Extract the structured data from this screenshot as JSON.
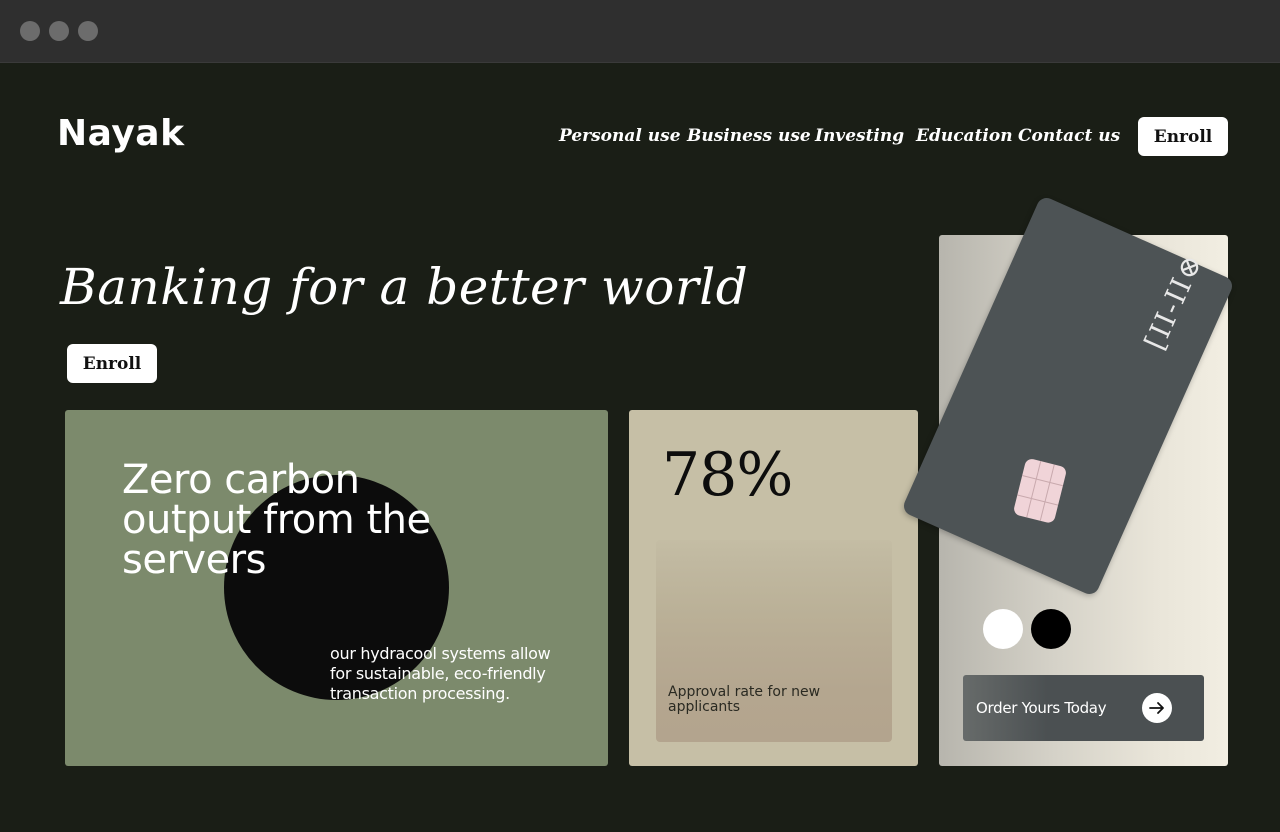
{
  "brand": {
    "name": "Nayak"
  },
  "nav": {
    "items": [
      "Personal use",
      "Business use",
      "Investing",
      "Education",
      "Contact us"
    ],
    "cta_label": "Enroll"
  },
  "hero": {
    "title": "Banking for a better world",
    "cta_label": "Enroll"
  },
  "feature_card": {
    "title": "Zero carbon output from the servers",
    "description": "our hydracool systems allow for sustainable, eco-friendly transaction processing."
  },
  "stat_card": {
    "value": "78%",
    "caption": "Approval rate for new applicants"
  },
  "product_card": {
    "card_mark": "[II-II⊗",
    "color_options": [
      "white",
      "black"
    ],
    "order_label": "Order Yours Today",
    "order_icon": "arrow-right-icon"
  },
  "colors": {
    "background": "#1a1e16",
    "green_card": "#7c8a6c",
    "beige_card": "#c6bfa6",
    "bank_card": "#4d5355",
    "chip": "#f0d4d8"
  }
}
